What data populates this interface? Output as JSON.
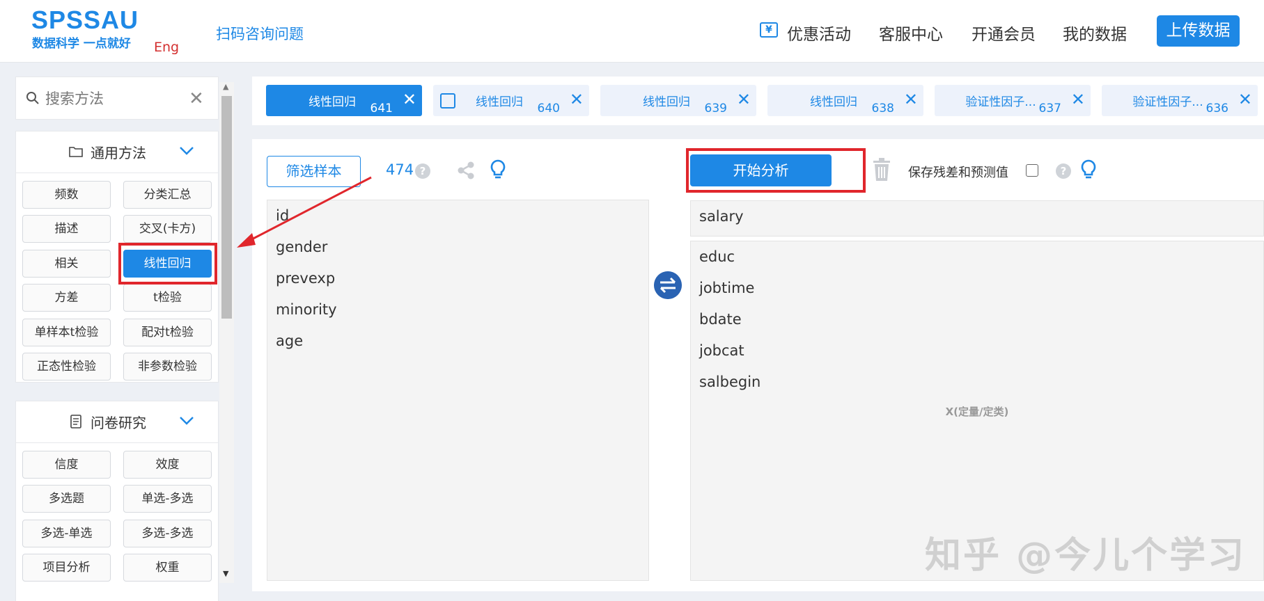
{
  "header": {
    "logo_main": "SPSSAU",
    "logo_sub": "数据科学 一点就好",
    "logo_eng": "Eng",
    "consult_link": "扫码咨询问题",
    "nav": {
      "promo": "优惠活动",
      "service": "客服中心",
      "member": "开通会员",
      "mydata": "我的数据",
      "upload": "上传数据"
    }
  },
  "sidebar": {
    "search_placeholder": "搜索方法",
    "sections": [
      {
        "title": "通用方法",
        "buttons": [
          "频数",
          "分类汇总",
          "描述",
          "交叉(卡方)",
          "相关",
          "线性回归",
          "方差",
          "t检验",
          "单样本t检验",
          "配对t检验",
          "正态性检验",
          "非参数检验"
        ],
        "active": "线性回归"
      },
      {
        "title": "问卷研究",
        "buttons": [
          "信度",
          "效度",
          "多选题",
          "单选-多选",
          "多选-单选",
          "多选-多选",
          "项目分析",
          "权重"
        ]
      }
    ]
  },
  "tabs": [
    {
      "label": "线性回归",
      "num": "641",
      "active": true
    },
    {
      "label": "线性回归",
      "num": "640",
      "edit": true
    },
    {
      "label": "线性回归",
      "num": "639"
    },
    {
      "label": "线性回归",
      "num": "638"
    },
    {
      "label": "验证性因子...",
      "num": "637"
    },
    {
      "label": "验证性因子...",
      "num": "636"
    }
  ],
  "workspace": {
    "filter_label": "筛选样本",
    "sample_count": "474",
    "start_label": "开始分析",
    "save_label": "保存残差和预测值",
    "available_vars": [
      "id",
      "gender",
      "prevexp",
      "minority",
      "age"
    ],
    "y_var": "salary",
    "x_vars": [
      "educ",
      "jobtime",
      "bdate",
      "jobcat",
      "salbegin"
    ],
    "x_hint": "X(定量/定类)"
  },
  "watermark": "知乎 @今儿个学习",
  "colors": {
    "accent": "#1e88e5",
    "highlight": "#e0262c"
  }
}
